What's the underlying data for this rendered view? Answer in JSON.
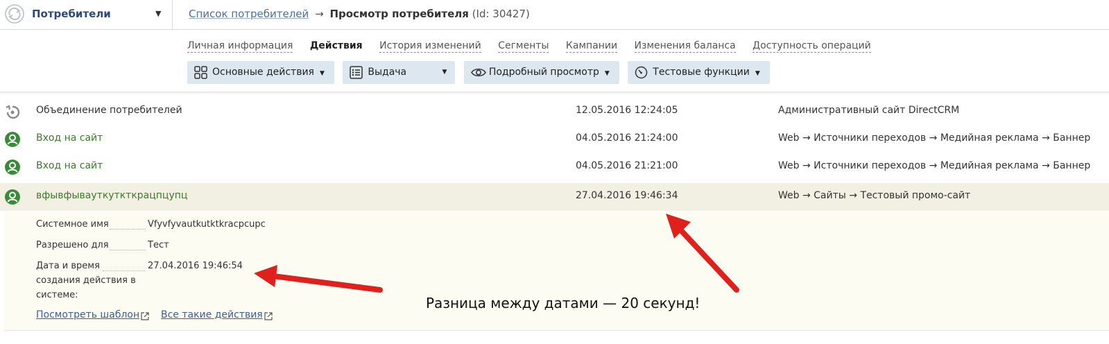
{
  "header": {
    "entity_label": "Потребители",
    "breadcrumb_link": "Список потребителей",
    "breadcrumb_arrow": "→",
    "breadcrumb_current": "Просмотр потребителя",
    "breadcrumb_id": "(Id: 30427)"
  },
  "tabs": [
    {
      "label": "Личная информация",
      "active": false
    },
    {
      "label": "Действия",
      "active": true
    },
    {
      "label": "История изменений",
      "active": false
    },
    {
      "label": "Сегменты",
      "active": false
    },
    {
      "label": "Кампании",
      "active": false
    },
    {
      "label": "Изменения баланса",
      "active": false
    },
    {
      "label": "Доступность операций",
      "active": false
    }
  ],
  "action_buttons": [
    {
      "label": "Основные действия",
      "icon": "grid-icon"
    },
    {
      "label": "Выдача",
      "icon": "list-icon"
    },
    {
      "label": "Подробный просмотр",
      "icon": "eye-icon"
    },
    {
      "label": "Тестовые функции",
      "icon": "gauge-icon"
    }
  ],
  "actions": [
    {
      "name": "Объединение потребителей",
      "date": "12.05.2016 12:24:05",
      "channel": "Административный сайт DirectCRM",
      "icon": "merge-icon"
    },
    {
      "name": "Вход на сайт",
      "date": "04.05.2016 21:24:00",
      "channel": "Web → Источники переходов → Медийная реклама → Баннер",
      "icon": "user-icon"
    },
    {
      "name": "Вход на сайт",
      "date": "04.05.2016 21:21:00",
      "channel": "Web → Источники переходов → Медийная реклама → Баннер",
      "icon": "user-icon"
    },
    {
      "name": "вфывфывауткуткткрацпцупц",
      "date": "27.04.2016 19:46:34",
      "channel": "Web → Сайты → Тестовый промо-сайт",
      "icon": "user-icon",
      "selected": true
    }
  ],
  "details": {
    "system_name_label": "Системное имя",
    "system_name_value": "Vfyvfyvautkutktkracpcupc",
    "allowed_for_label": "Разрешено для",
    "allowed_for_value": "Тест",
    "created_label_line1": "Дата и время",
    "created_label_line2": "создания действия в",
    "created_label_line3": "системе:",
    "created_value": "27.04.2016 19:46:54",
    "view_template_link": "Посмотреть шаблон",
    "all_such_actions_link": "Все такие действия"
  },
  "annotation": {
    "text": "Разница между датами — 20 секунд!",
    "arrow_color": "#e0201b"
  },
  "colors": {
    "green_icon": "#3a8a3a",
    "selected_row": "#f2f0e2",
    "detail_bg": "#fdfcf2",
    "button_bg": "#dce7f0",
    "link": "#3b5e9a"
  }
}
